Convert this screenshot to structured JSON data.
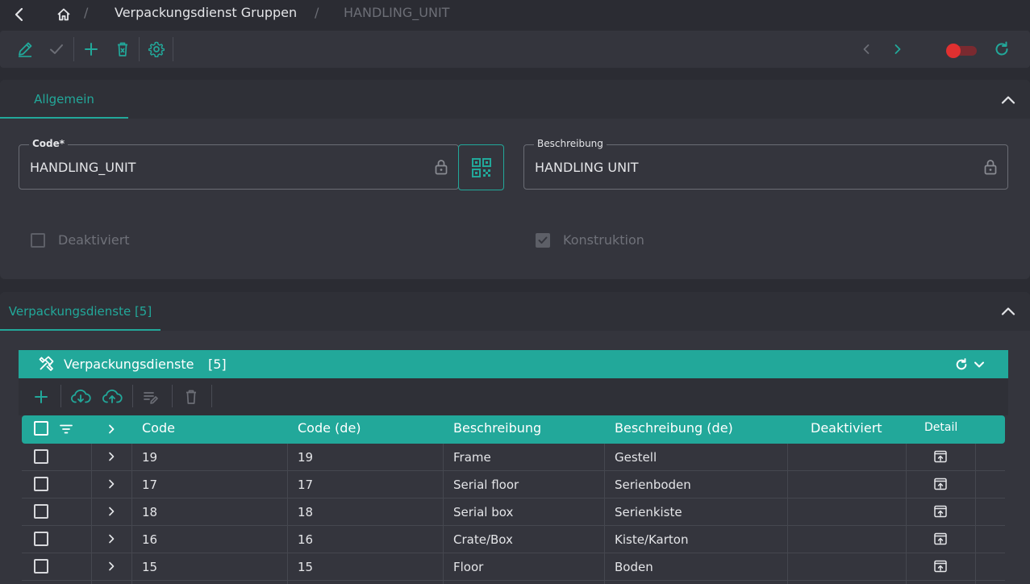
{
  "breadcrumb": {
    "separator": "/",
    "group": "Verpackungsdienst Gruppen",
    "current": "HANDLING_UNIT"
  },
  "colors": {
    "accent": "#22a89a",
    "toggle_off": "#e03030",
    "background": "#2b2c33",
    "panel": "#34353d"
  },
  "tabs": {
    "general": "Allgemein",
    "services": "Verpackungsdienste [5]"
  },
  "form": {
    "code_label": "Code*",
    "code_value": "HANDLING_UNIT",
    "description_label": "Beschreibung",
    "description_value": "HANDLING UNIT",
    "deactivated_label": "Deaktiviert",
    "deactivated_checked": false,
    "construction_label": "Konstruktion",
    "construction_checked": true
  },
  "grid": {
    "title": "Verpackungsdienste",
    "count": "[5]",
    "columns": {
      "code": "Code",
      "code_de": "Code (de)",
      "description": "Beschreibung",
      "description_de": "Beschreibung (de)",
      "deactivated": "Deaktiviert",
      "detail": "Detail"
    },
    "rows": [
      {
        "code": "19",
        "code_de": "19",
        "description": "Frame",
        "description_de": "Gestell"
      },
      {
        "code": "17",
        "code_de": "17",
        "description": "Serial floor",
        "description_de": "Serienboden"
      },
      {
        "code": "18",
        "code_de": "18",
        "description": "Serial box",
        "description_de": "Serienkiste"
      },
      {
        "code": "16",
        "code_de": "16",
        "description": "Crate/Box",
        "description_de": "Kiste/Karton"
      },
      {
        "code": "15",
        "code_de": "15",
        "description": "Floor",
        "description_de": "Boden"
      }
    ]
  }
}
